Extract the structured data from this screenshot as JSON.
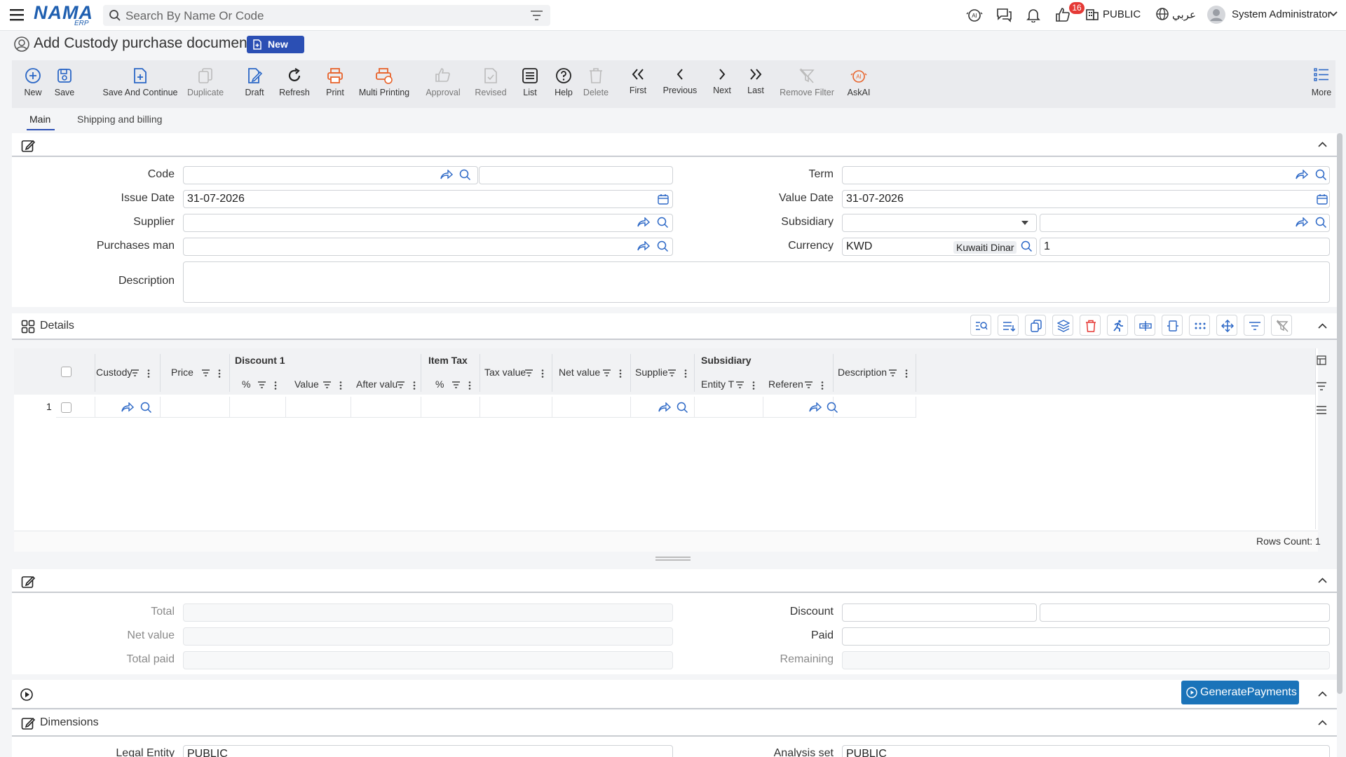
{
  "header": {
    "logo": "NAMA",
    "logo_sub": "ERP",
    "search_placeholder": "Search By Name Or Code",
    "notifications_badge": "16",
    "company": "PUBLIC",
    "language": "عربي",
    "user": "System Administrator"
  },
  "page": {
    "title": "Add Custody purchase document",
    "status_badge": "New"
  },
  "toolbar": [
    {
      "label": "New",
      "icon": "plus-circle-icon",
      "enabled": true
    },
    {
      "label": "Save",
      "icon": "save-icon",
      "enabled": true
    },
    {
      "label": "Save And Continue",
      "icon": "save-continue-icon",
      "enabled": true
    },
    {
      "label": "Duplicate",
      "icon": "duplicate-icon",
      "enabled": false
    },
    {
      "label": "Draft",
      "icon": "draft-icon",
      "enabled": true
    },
    {
      "label": "Refresh",
      "icon": "refresh-icon",
      "enabled": true
    },
    {
      "label": "Print",
      "icon": "print-icon",
      "enabled": true
    },
    {
      "label": "Multi Printing",
      "icon": "multi-print-icon",
      "enabled": true
    },
    {
      "label": "Approval",
      "icon": "thumbs-up-icon",
      "enabled": false
    },
    {
      "label": "Revised",
      "icon": "revised-icon",
      "enabled": false
    },
    {
      "label": "List",
      "icon": "list-icon",
      "enabled": true
    },
    {
      "label": "Help",
      "icon": "help-icon",
      "enabled": true
    },
    {
      "label": "Delete",
      "icon": "trash-icon",
      "enabled": false
    },
    {
      "label": "First",
      "icon": "first-icon",
      "enabled": true
    },
    {
      "label": "Previous",
      "icon": "previous-icon",
      "enabled": true
    },
    {
      "label": "Next",
      "icon": "next-icon",
      "enabled": true
    },
    {
      "label": "Last",
      "icon": "last-icon",
      "enabled": true
    },
    {
      "label": "Remove Filter",
      "icon": "remove-filter-icon",
      "enabled": false
    },
    {
      "label": "AskAI",
      "icon": "ai-icon",
      "enabled": true
    },
    {
      "label": "More",
      "icon": "more-icon",
      "enabled": true
    }
  ],
  "tabs": [
    "Main",
    "Shipping and billing"
  ],
  "main_form": {
    "code_label": "Code",
    "code_value": "",
    "issue_date_label": "Issue Date",
    "issue_date_value": "31-07-2026",
    "supplier_label": "Supplier",
    "supplier_value": "",
    "purchases_man_label": "Purchases man",
    "purchases_man_value": "",
    "description_label": "Description",
    "description_value": "",
    "term_label": "Term",
    "term_value": "",
    "value_date_label": "Value Date",
    "value_date_value": "31-07-2026",
    "subsidiary_label": "Subsidiary",
    "subsidiary_value": "",
    "currency_label": "Currency",
    "currency_code": "KWD",
    "currency_name": "Kuwaiti Dinar",
    "currency_rate": "1"
  },
  "details": {
    "title": "Details",
    "groups": {
      "discount": "Discount 1",
      "item_tax": "Item Tax",
      "subsidiary": "Subsidiary"
    },
    "columns": {
      "custody": "Custody",
      "price": "Price",
      "disc_pct": "%",
      "disc_value": "Value",
      "after_value": "After valu",
      "tax_pct": "%",
      "tax_value": "Tax value",
      "net_value": "Net value",
      "supplier": "Supplie",
      "entity_type": "Entity T",
      "reference": "Referen",
      "description": "Description"
    },
    "row_number": "1",
    "rows_count": "Rows Count: 1"
  },
  "totals": {
    "total_label": "Total",
    "total_value": "",
    "net_value_label": "Net value",
    "net_value_value": "",
    "total_paid_label": "Total paid",
    "total_paid_value": "",
    "discount_label": "Discount",
    "paid_label": "Paid",
    "remaining_label": "Remaining"
  },
  "actions": {
    "generate_payments": "GeneratePayments"
  },
  "dimensions": {
    "title": "Dimensions",
    "legal_entity_label": "Legal Entity",
    "legal_entity_value": "PUBLIC",
    "analysis_set_label": "Analysis set",
    "analysis_set_value": "PUBLIC"
  },
  "colors": {
    "primary": "#2b4fb4",
    "accent_orange": "#e8632b",
    "badge_red": "#e53935",
    "action_blue": "#1a73b9"
  }
}
